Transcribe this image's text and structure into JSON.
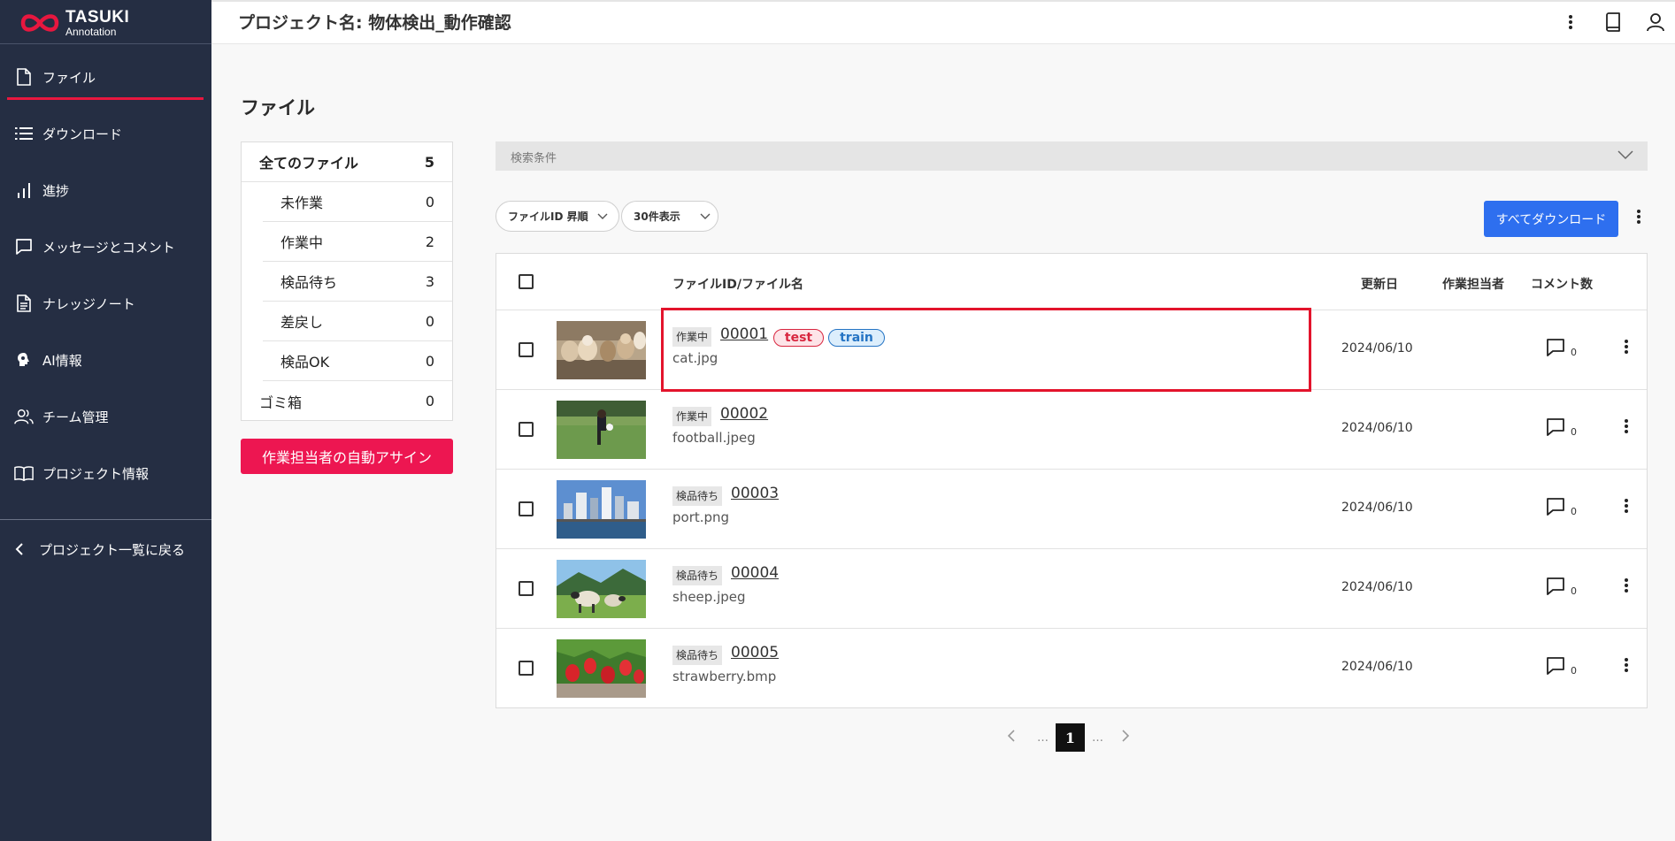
{
  "app": {
    "logo_line1": "TASUKI",
    "logo_line2": "Annotation",
    "accent_color": "#e8173f"
  },
  "header": {
    "project_title": "プロジェクト名: 物体検出_動作確認",
    "icons": [
      "more-vertical-icon",
      "book-icon",
      "user-icon"
    ]
  },
  "sidebar": {
    "items": [
      {
        "label": "ファイル",
        "icon": "file-icon",
        "active": true
      },
      {
        "label": "ダウンロード",
        "icon": "list-icon"
      },
      {
        "label": "進捗",
        "icon": "bar-chart-icon"
      },
      {
        "label": "メッセージとコメント",
        "icon": "message-icon"
      },
      {
        "label": "ナレッジノート",
        "icon": "document-icon"
      },
      {
        "label": "AI情報",
        "icon": "brain-icon"
      },
      {
        "label": "チーム管理",
        "icon": "team-icon"
      },
      {
        "label": "プロジェクト情報",
        "icon": "open-book-icon"
      }
    ],
    "back_label": "プロジェクト一覧に戻る"
  },
  "main": {
    "heading": "ファイル",
    "filters": {
      "all": {
        "label": "全てのファイル",
        "count": "5"
      },
      "sub": [
        {
          "label": "未作業",
          "count": "0"
        },
        {
          "label": "作業中",
          "count": "2"
        },
        {
          "label": "検品待ち",
          "count": "3"
        },
        {
          "label": "差戻し",
          "count": "0"
        },
        {
          "label": "検品OK",
          "count": "0"
        }
      ],
      "trash": {
        "label": "ゴミ箱",
        "count": "0"
      }
    },
    "auto_assign_label": "作業担当者の自動アサイン",
    "search_label": "検索条件",
    "sort_label": "ファイルID 昇順",
    "per_page_label": "30件表示",
    "download_all_label": "すべてダウンロード",
    "table": {
      "headers": {
        "file": "ファイルID/ファイル名",
        "updated": "更新日",
        "assignee": "作業担当者",
        "comments": "コメント数"
      },
      "rows": [
        {
          "status": "作業中",
          "id": "00001",
          "filename": "cat.jpg",
          "tags": [
            "test",
            "train"
          ],
          "date": "2024/06/10",
          "comments": "0",
          "thumb": "cats"
        },
        {
          "status": "作業中",
          "id": "00002",
          "filename": "football.jpeg",
          "tags": [],
          "date": "2024/06/10",
          "comments": "0",
          "thumb": "football"
        },
        {
          "status": "検品待ち",
          "id": "00003",
          "filename": "port.png",
          "tags": [],
          "date": "2024/06/10",
          "comments": "0",
          "thumb": "port"
        },
        {
          "status": "検品待ち",
          "id": "00004",
          "filename": "sheep.jpeg",
          "tags": [],
          "date": "2024/06/10",
          "comments": "0",
          "thumb": "sheep"
        },
        {
          "status": "検品待ち",
          "id": "00005",
          "filename": "strawberry.bmp",
          "tags": [],
          "date": "2024/06/10",
          "comments": "0",
          "thumb": "strawberry"
        }
      ]
    },
    "pagination": {
      "current": "1",
      "ellipsis": "…"
    }
  }
}
